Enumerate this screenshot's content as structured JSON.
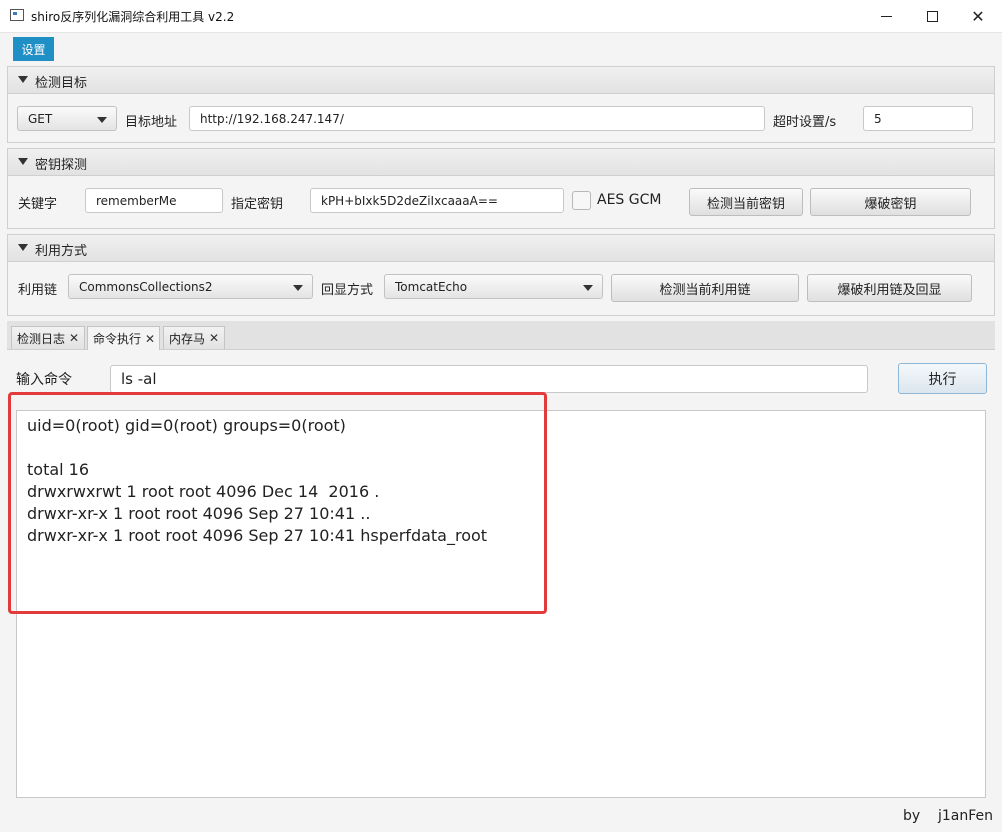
{
  "window": {
    "title": "shiro反序列化漏洞综合利用工具 v2.2",
    "icons": [
      "app-icon",
      "minimize-icon",
      "maximize-icon",
      "close-icon"
    ]
  },
  "menu": {
    "settings": "设置"
  },
  "detect_target": {
    "title": "检测目标",
    "method": "GET",
    "url_label": "目标地址",
    "url_value": "http://192.168.247.147/",
    "timeout_label": "超时设置/s",
    "timeout_value": "5"
  },
  "key_detect": {
    "title": "密钥探测",
    "keyword_label": "关键字",
    "keyword_value": "rememberMe",
    "key_label": "指定密钥",
    "key_value": "kPH+bIxk5D2deZiIxcaaaA==",
    "aes_gcm_label": "AES GCM",
    "aes_gcm_checked": false,
    "check_key_button": "检测当前密钥",
    "brute_key_button": "爆破密钥"
  },
  "exploit": {
    "title": "利用方式",
    "chain_label": "利用链",
    "chain_value": "CommonsCollections2",
    "echo_label": "回显方式",
    "echo_value": "TomcatEcho",
    "check_chain_button": "检测当前利用链",
    "brute_chain_button": "爆破利用链及回显"
  },
  "tabs": [
    {
      "label": "检测日志",
      "active": false
    },
    {
      "label": "命令执行",
      "active": true
    },
    {
      "label": "内存马",
      "active": false
    }
  ],
  "command": {
    "label": "输入命令",
    "value": "ls -al",
    "execute_button": "执行"
  },
  "output_lines": [
    "uid=0(root) gid=0(root) groups=0(root)",
    "",
    "total 16",
    "drwxrwxrwt 1 root root 4096 Dec 14  2016 .",
    "drwxr-xr-x 1 root root 4096 Sep 27 10:41 ..",
    "drwxr-xr-x 1 root root 4096 Sep 27 10:41 hsperfdata_root"
  ],
  "highlight_color": "#e23b3b",
  "accent_color": "#1f8fc6",
  "footer": {
    "author": "by    j1anFen"
  }
}
